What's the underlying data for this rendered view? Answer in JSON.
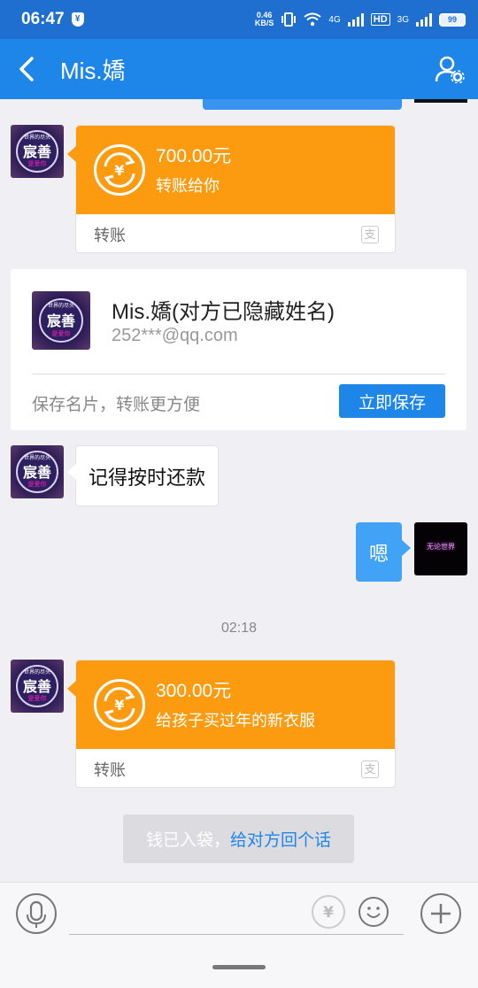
{
  "status_bar": {
    "time": "06:47",
    "net_speed_value": "0.46",
    "net_speed_unit": "KB/S",
    "net_4g": "4G",
    "net_hd": "HD",
    "net_3g": "3G",
    "battery": "99"
  },
  "header": {
    "title": "Mis.嬌"
  },
  "messages": {
    "transfer1": {
      "amount": "700.00元",
      "note": "转账给你",
      "label": "转账"
    },
    "contact_card": {
      "name": "Mis.嬌(对方已隐藏姓名)",
      "email": "252***@qq.com",
      "hint": "保存名片，转账更方便",
      "save_button": "立即保存"
    },
    "text1": "记得按时还款",
    "reply1": "嗯",
    "timestamp": "02:18",
    "transfer2": {
      "amount": "300.00元",
      "note": "给孩子买过年的新衣服",
      "label": "转账"
    },
    "system_tip": {
      "text": "钱已入袋，",
      "link": "给对方回个话"
    }
  },
  "avatars": {
    "left_text": "宸善",
    "left_small_text": "世界的尽头",
    "left_red_text": "是爱你",
    "right_text": "无论世界"
  },
  "colors": {
    "header_blue": "#1e86e8",
    "transfer_orange": "#fc9b10",
    "bubble_blue": "#42a2f5"
  }
}
